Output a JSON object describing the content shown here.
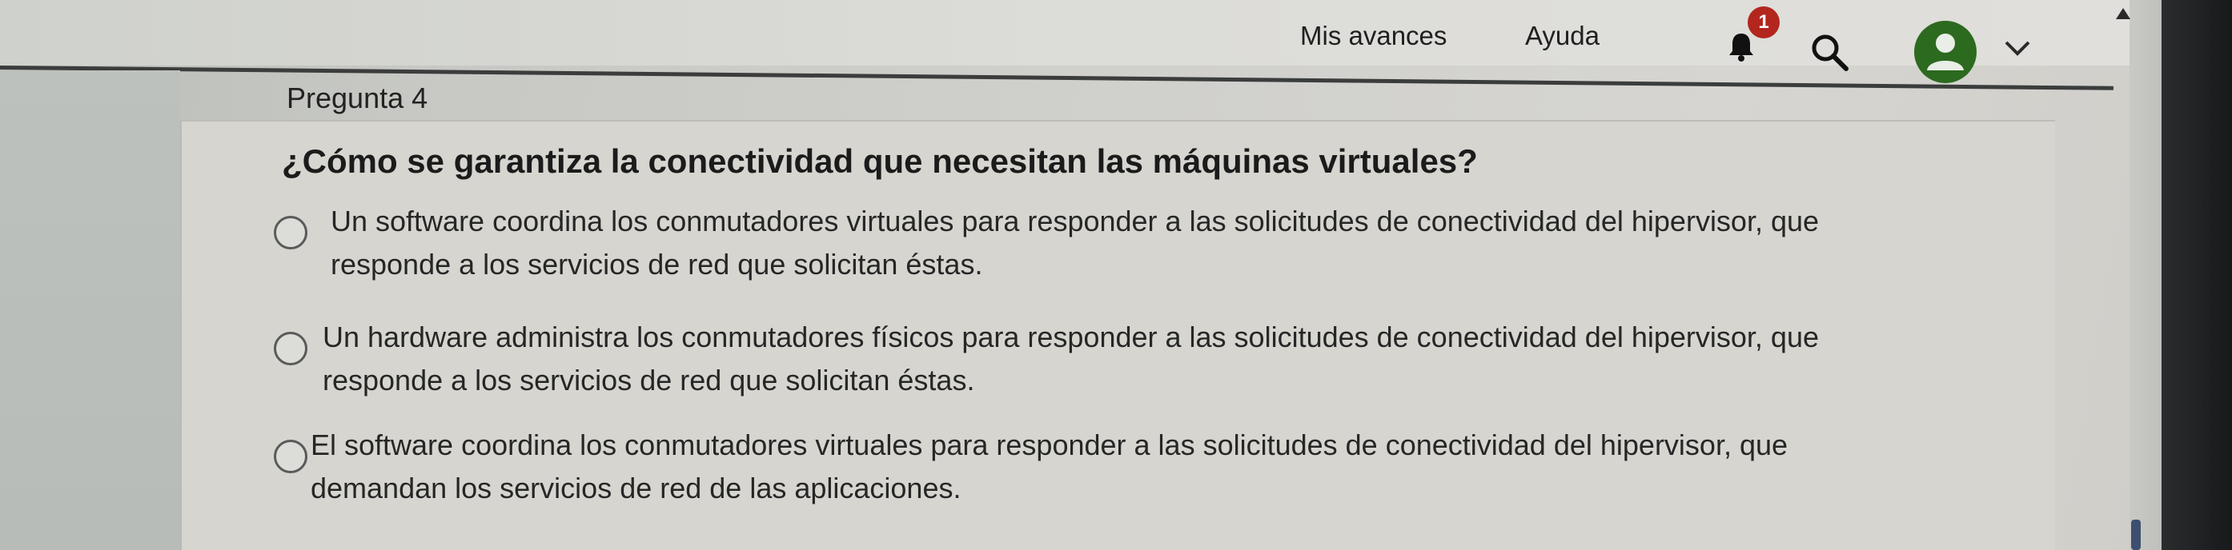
{
  "nav": {
    "progress_label": "Mis avances",
    "help_label": "Ayuda",
    "notification_count": "1",
    "icons": {
      "bell": "bell-icon",
      "search": "search-icon",
      "avatar": "user-avatar-icon",
      "chevron": "chevron-down-icon",
      "scroll_up": "triangle-up-icon"
    },
    "colors": {
      "badge": "#b3261e",
      "avatar": "#2c6a1f"
    }
  },
  "question": {
    "number": "Pregunta 4",
    "text": "¿Cómo se garantiza la conectividad que necesitan las máquinas virtuales?",
    "options": [
      {
        "line1": "Un software coordina los conmutadores virtuales para responder a las solicitudes de conectividad del hipervisor, que",
        "line2": "responde a los servicios de red que solicitan éstas."
      },
      {
        "line1": "Un hardware administra los conmutadores físicos para responder a las solicitudes de conectividad del hipervisor, que",
        "line2": "responde a los servicios de red que solicitan éstas."
      },
      {
        "line1": "El software coordina los conmutadores virtuales para responder a las solicitudes de conectividad del hipervisor, que",
        "line2": "demandan los servicios de red de las aplicaciones."
      }
    ]
  }
}
